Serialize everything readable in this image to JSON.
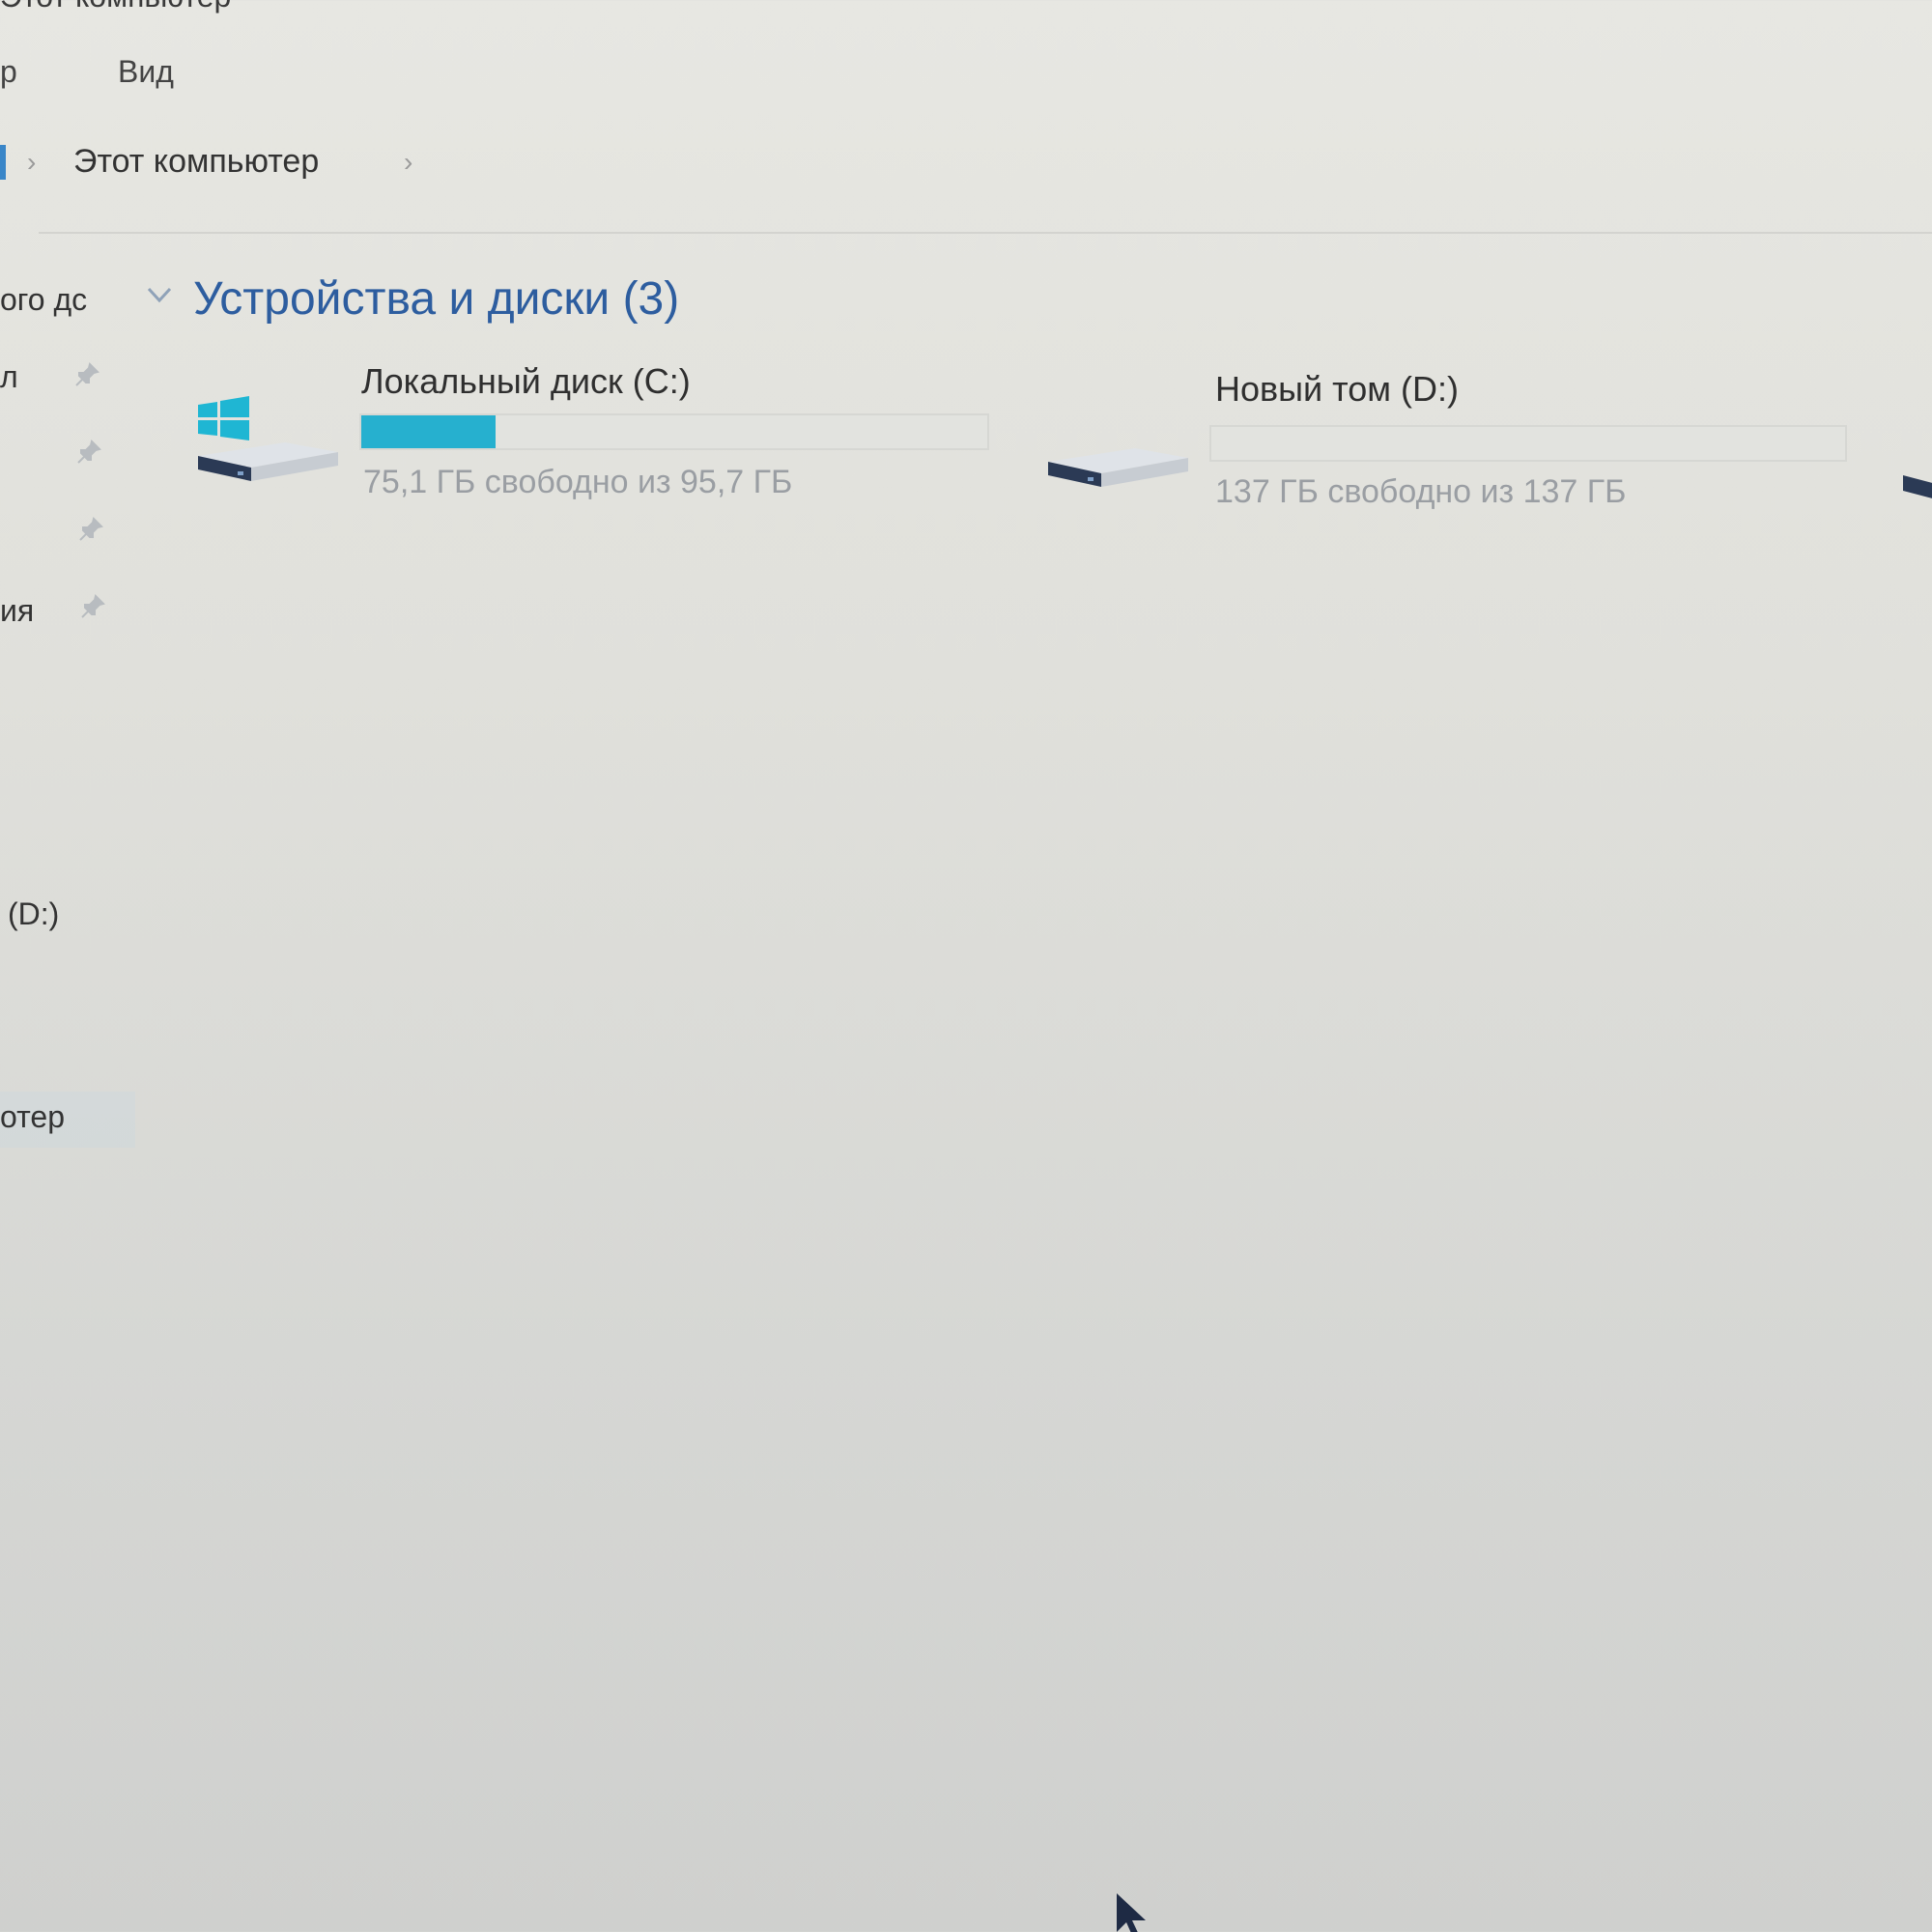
{
  "window": {
    "title": "Этот компьютер"
  },
  "ribbon": {
    "tabs": [
      {
        "label": "р",
        "partial": true
      },
      {
        "label": "Вид"
      }
    ]
  },
  "address_bar": {
    "crumbs": [
      "Этот компьютер"
    ],
    "separator": "›"
  },
  "nav_pane": {
    "items": [
      {
        "label": "ого дс",
        "partial": true
      },
      {
        "label": "л",
        "partial": true,
        "icon": "pin-icon"
      },
      {
        "label": "",
        "icon": "pin-icon"
      },
      {
        "label": "",
        "icon": "pin-icon"
      },
      {
        "label": "ия",
        "partial": true,
        "icon": "pin-icon"
      },
      {
        "label": "(D:)",
        "partial": true
      },
      {
        "label": "отер",
        "partial": true,
        "selected": true
      }
    ]
  },
  "main": {
    "section_title": "Устройства и диски (3)",
    "drives": [
      {
        "name": "Локальный диск (C:)",
        "free_text": "75,1 ГБ свободно из 95,7 ГБ",
        "used_fraction": 0.215,
        "icon": "windows-drive-icon"
      },
      {
        "name": "Новый том (D:)",
        "free_text": "137 ГБ свободно из 137 ГБ",
        "used_fraction": 0.0,
        "icon": "hard-drive-icon"
      }
    ]
  },
  "colors": {
    "accent": "#26b0cf",
    "section_title": "#2d5d9f",
    "windows_logo": "#1fb6d3"
  }
}
